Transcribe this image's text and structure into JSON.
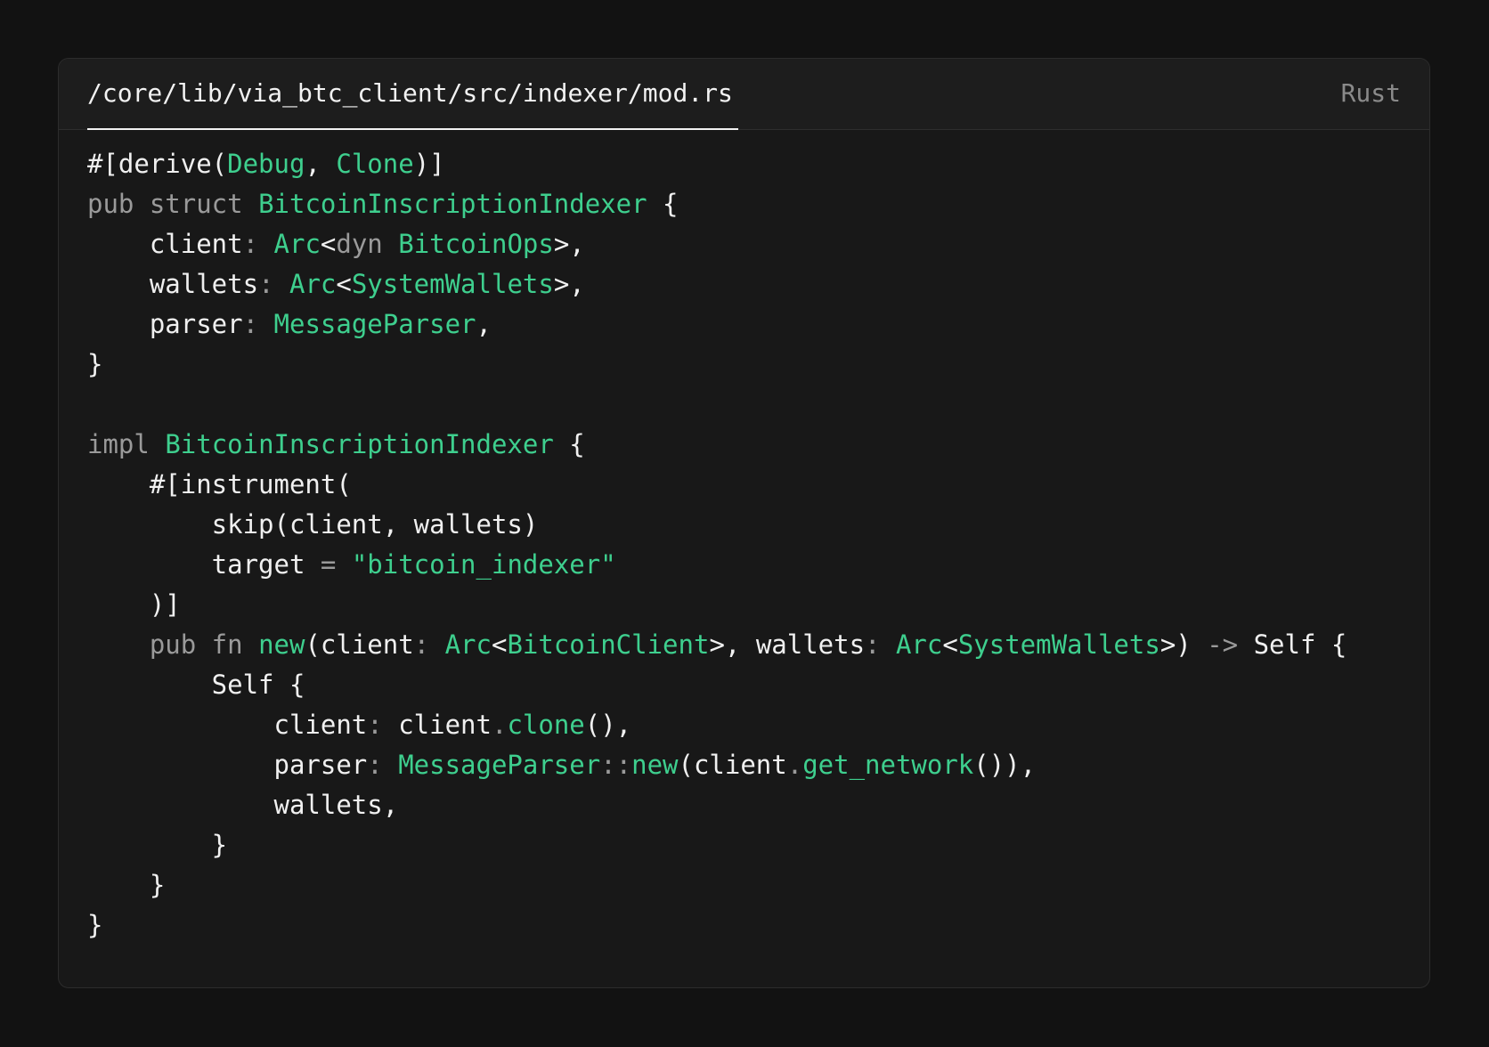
{
  "file": {
    "path": "/core/lib/via_btc_client/src/indexer/mod.rs",
    "language": "Rust"
  },
  "colors": {
    "background": "#121212",
    "panel": "#181818",
    "accent": "#3ecf8e",
    "keyword": "#9a9a9a",
    "text": "#f0f0f0"
  },
  "code": {
    "lines": [
      [
        {
          "t": "tx",
          "v": "#[derive("
        },
        {
          "t": "ty",
          "v": "Debug"
        },
        {
          "t": "tx",
          "v": ", "
        },
        {
          "t": "ty",
          "v": "Clone"
        },
        {
          "t": "tx",
          "v": ")]"
        }
      ],
      [
        {
          "t": "kw",
          "v": "pub struct "
        },
        {
          "t": "ty",
          "v": "BitcoinInscriptionIndexer"
        },
        {
          "t": "tx",
          "v": " {"
        }
      ],
      [
        {
          "t": "tx",
          "v": "    client"
        },
        {
          "t": "pu",
          "v": ": "
        },
        {
          "t": "ty",
          "v": "Arc"
        },
        {
          "t": "tx",
          "v": "<"
        },
        {
          "t": "kw",
          "v": "dyn "
        },
        {
          "t": "ty",
          "v": "BitcoinOps"
        },
        {
          "t": "tx",
          "v": ">,"
        }
      ],
      [
        {
          "t": "tx",
          "v": "    wallets"
        },
        {
          "t": "pu",
          "v": ": "
        },
        {
          "t": "ty",
          "v": "Arc"
        },
        {
          "t": "tx",
          "v": "<"
        },
        {
          "t": "ty",
          "v": "SystemWallets"
        },
        {
          "t": "tx",
          "v": ">,"
        }
      ],
      [
        {
          "t": "tx",
          "v": "    parser"
        },
        {
          "t": "pu",
          "v": ": "
        },
        {
          "t": "ty",
          "v": "MessageParser"
        },
        {
          "t": "tx",
          "v": ","
        }
      ],
      [
        {
          "t": "tx",
          "v": "}"
        }
      ],
      [
        {
          "t": "tx",
          "v": ""
        }
      ],
      [
        {
          "t": "kw",
          "v": "impl "
        },
        {
          "t": "ty",
          "v": "BitcoinInscriptionIndexer"
        },
        {
          "t": "tx",
          "v": " {"
        }
      ],
      [
        {
          "t": "tx",
          "v": "    #[instrument("
        }
      ],
      [
        {
          "t": "tx",
          "v": "        skip(client, wallets)"
        }
      ],
      [
        {
          "t": "tx",
          "v": "        target "
        },
        {
          "t": "pu",
          "v": "="
        },
        {
          "t": "tx",
          "v": " "
        },
        {
          "t": "st",
          "v": "\"bitcoin_indexer\""
        }
      ],
      [
        {
          "t": "tx",
          "v": "    )]"
        }
      ],
      [
        {
          "t": "kw",
          "v": "    pub fn "
        },
        {
          "t": "fn",
          "v": "new"
        },
        {
          "t": "tx",
          "v": "(client"
        },
        {
          "t": "pu",
          "v": ": "
        },
        {
          "t": "ty",
          "v": "Arc"
        },
        {
          "t": "tx",
          "v": "<"
        },
        {
          "t": "ty",
          "v": "BitcoinClient"
        },
        {
          "t": "tx",
          "v": ">, wallets"
        },
        {
          "t": "pu",
          "v": ": "
        },
        {
          "t": "ty",
          "v": "Arc"
        },
        {
          "t": "tx",
          "v": "<"
        },
        {
          "t": "ty",
          "v": "SystemWallets"
        },
        {
          "t": "tx",
          "v": ">) "
        },
        {
          "t": "pu",
          "v": "->"
        },
        {
          "t": "tx",
          "v": " Self {"
        }
      ],
      [
        {
          "t": "tx",
          "v": "        Self {"
        }
      ],
      [
        {
          "t": "tx",
          "v": "            client"
        },
        {
          "t": "pu",
          "v": ": "
        },
        {
          "t": "tx",
          "v": "client"
        },
        {
          "t": "pu",
          "v": "."
        },
        {
          "t": "fn",
          "v": "clone"
        },
        {
          "t": "tx",
          "v": "(),"
        }
      ],
      [
        {
          "t": "tx",
          "v": "            parser"
        },
        {
          "t": "pu",
          "v": ": "
        },
        {
          "t": "ty",
          "v": "MessageParser"
        },
        {
          "t": "pu",
          "v": "::"
        },
        {
          "t": "fn",
          "v": "new"
        },
        {
          "t": "tx",
          "v": "(client"
        },
        {
          "t": "pu",
          "v": "."
        },
        {
          "t": "fn",
          "v": "get_network"
        },
        {
          "t": "tx",
          "v": "()),"
        }
      ],
      [
        {
          "t": "tx",
          "v": "            wallets,"
        }
      ],
      [
        {
          "t": "tx",
          "v": "        }"
        }
      ],
      [
        {
          "t": "tx",
          "v": "    }"
        }
      ],
      [
        {
          "t": "tx",
          "v": "}"
        }
      ]
    ]
  }
}
